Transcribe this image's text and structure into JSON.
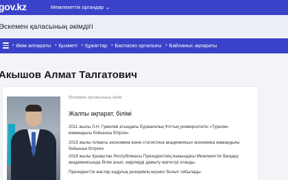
{
  "header": {
    "logo": "gov.kz",
    "org_dropdown_label": "Мемлекеттік органдар"
  },
  "akimat": {
    "title": "Өскемен қаласының әкімдігі"
  },
  "nav": {
    "items": [
      {
        "label": "Әкім аппараты"
      },
      {
        "label": "Қызметі"
      },
      {
        "label": "Құжаттар"
      },
      {
        "label": "Баспасөз орталығы"
      },
      {
        "label": "Байланыс ақпараты"
      }
    ]
  },
  "person": {
    "name": "Акышов Алмат Талгатович"
  },
  "card": {
    "subtitle": "Өскемен қаласының әкімі",
    "section_title": "Жалпы ақпарат, білімі",
    "paragraphs": [
      "2011 жылы Л.Н. Гумилев атындағы Еуразиялық Ұлттық университетін «Туризм» мамандығы бойынша бітірген.",
      "2015 жылы Алматы экономика және статистика академиясын экономика мамандығы бойынша бітірген.",
      "2018 жылы Қазақстан Республикасы Президентінің жанындағы Мемлекеттік басқару академиясында білім алып, өңірлерді дамыту магистрі атанды.",
      "Президенттік жастар кадрлық резервінің мүшесі болып табылады."
    ]
  },
  "colors": {
    "brand_blue": "#3a42c9",
    "band_bg": "#eceef6"
  }
}
